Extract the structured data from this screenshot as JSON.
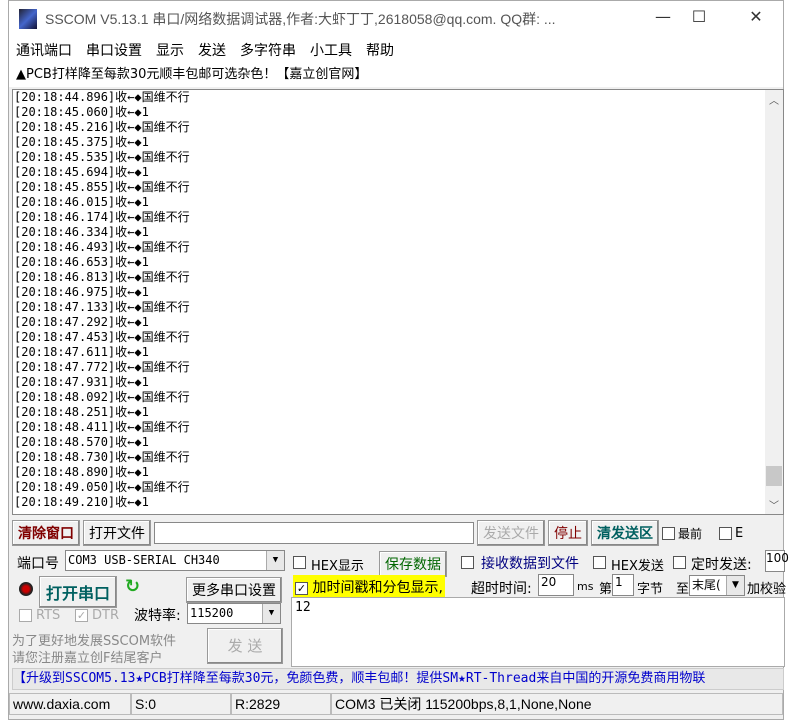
{
  "window": {
    "title": "SSCOM V5.13.1 串口/网络数据调试器,作者:大虾丁丁,2618058@qq.com. QQ群: ...",
    "minimize": "—",
    "maximize": "☐",
    "close": "✕"
  },
  "menu": [
    "通讯端口",
    "串口设置",
    "显示",
    "发送",
    "多字符串",
    "小工具",
    "帮助"
  ],
  "ad": "▲PCB打样降至每款30元顺丰包邮可选杂色！【嘉立创官网】",
  "log": [
    {
      "t": "[20:18:44.896]收←◆",
      "m": "国维不行"
    },
    {
      "t": "[20:18:45.060]收←◆",
      "m": "1"
    },
    {
      "t": "[20:18:45.216]收←◆",
      "m": "国维不行"
    },
    {
      "t": "[20:18:45.375]收←◆",
      "m": "1"
    },
    {
      "t": "[20:18:45.535]收←◆",
      "m": "国维不行"
    },
    {
      "t": "[20:18:45.694]收←◆",
      "m": "1"
    },
    {
      "t": "[20:18:45.855]收←◆",
      "m": "国维不行"
    },
    {
      "t": "[20:18:46.015]收←◆",
      "m": "1"
    },
    {
      "t": "[20:18:46.174]收←◆",
      "m": "国维不行"
    },
    {
      "t": "[20:18:46.334]收←◆",
      "m": "1"
    },
    {
      "t": "[20:18:46.493]收←◆",
      "m": "国维不行"
    },
    {
      "t": "[20:18:46.653]收←◆",
      "m": "1"
    },
    {
      "t": "[20:18:46.813]收←◆",
      "m": "国维不行"
    },
    {
      "t": "[20:18:46.975]收←◆",
      "m": "1"
    },
    {
      "t": "[20:18:47.133]收←◆",
      "m": "国维不行"
    },
    {
      "t": "[20:18:47.292]收←◆",
      "m": "1"
    },
    {
      "t": "[20:18:47.453]收←◆",
      "m": "国维不行"
    },
    {
      "t": "[20:18:47.611]收←◆",
      "m": "1"
    },
    {
      "t": "[20:18:47.772]收←◆",
      "m": "国维不行"
    },
    {
      "t": "[20:18:47.931]收←◆",
      "m": "1"
    },
    {
      "t": "[20:18:48.092]收←◆",
      "m": "国维不行"
    },
    {
      "t": "[20:18:48.251]收←◆",
      "m": "1"
    },
    {
      "t": "[20:18:48.411]收←◆",
      "m": "国维不行"
    },
    {
      "t": "[20:18:48.570]收←◆",
      "m": "1"
    },
    {
      "t": "[20:18:48.730]收←◆",
      "m": "国维不行"
    },
    {
      "t": "[20:18:48.890]收←◆",
      "m": "1"
    },
    {
      "t": "[20:18:49.050]收←◆",
      "m": "国维不行"
    },
    {
      "t": "[20:18:49.210]收←◆",
      "m": "1"
    }
  ],
  "toolbar": {
    "clear": "清除窗口",
    "open_file": "打开文件",
    "file_path": "",
    "send_file": "发送文件",
    "stop": "停止",
    "clear_send": "清发送区",
    "topmost": "最前",
    "e": "E"
  },
  "port": {
    "label": "端口号",
    "value": "COM3 USB-SERIAL CH340",
    "open": "打开串口",
    "more": "更多串口设置",
    "rts": "RTS",
    "dtr": "DTR",
    "baud_label": "波特率:",
    "baud": "115200",
    "promo1": "为了更好地发展SSCOM软件",
    "promo2": "请您注册嘉立创F结尾客户",
    "send": "发 送"
  },
  "display": {
    "hex_show": "HEX显示",
    "save": "保存数据",
    "recv_file": "接收数据到文件",
    "hex_send": "HEX发送",
    "timed": "定时发送:",
    "timed_val": "100",
    "timestamp": "加时间戳和分包显示,",
    "timeout_label": "超时时间:",
    "timeout": "20",
    "ms": "ms",
    "nth": "第",
    "byte_val": "1",
    "byte": "字节",
    "to": "至",
    "end": "末尾(",
    "checksum": "加校验"
  },
  "send_text": "12",
  "marquee": "【升级到SSCOM5.13★PCB打样降至每款30元，免颜色费，顺丰包邮！提供SM★RT-Thread来自中国的开源免费商用物联",
  "status": {
    "site": "www.daxia.com",
    "s": "S:0",
    "r": "R:2829",
    "port": "COM3 已关闭  115200bps,8,1,None,None"
  }
}
